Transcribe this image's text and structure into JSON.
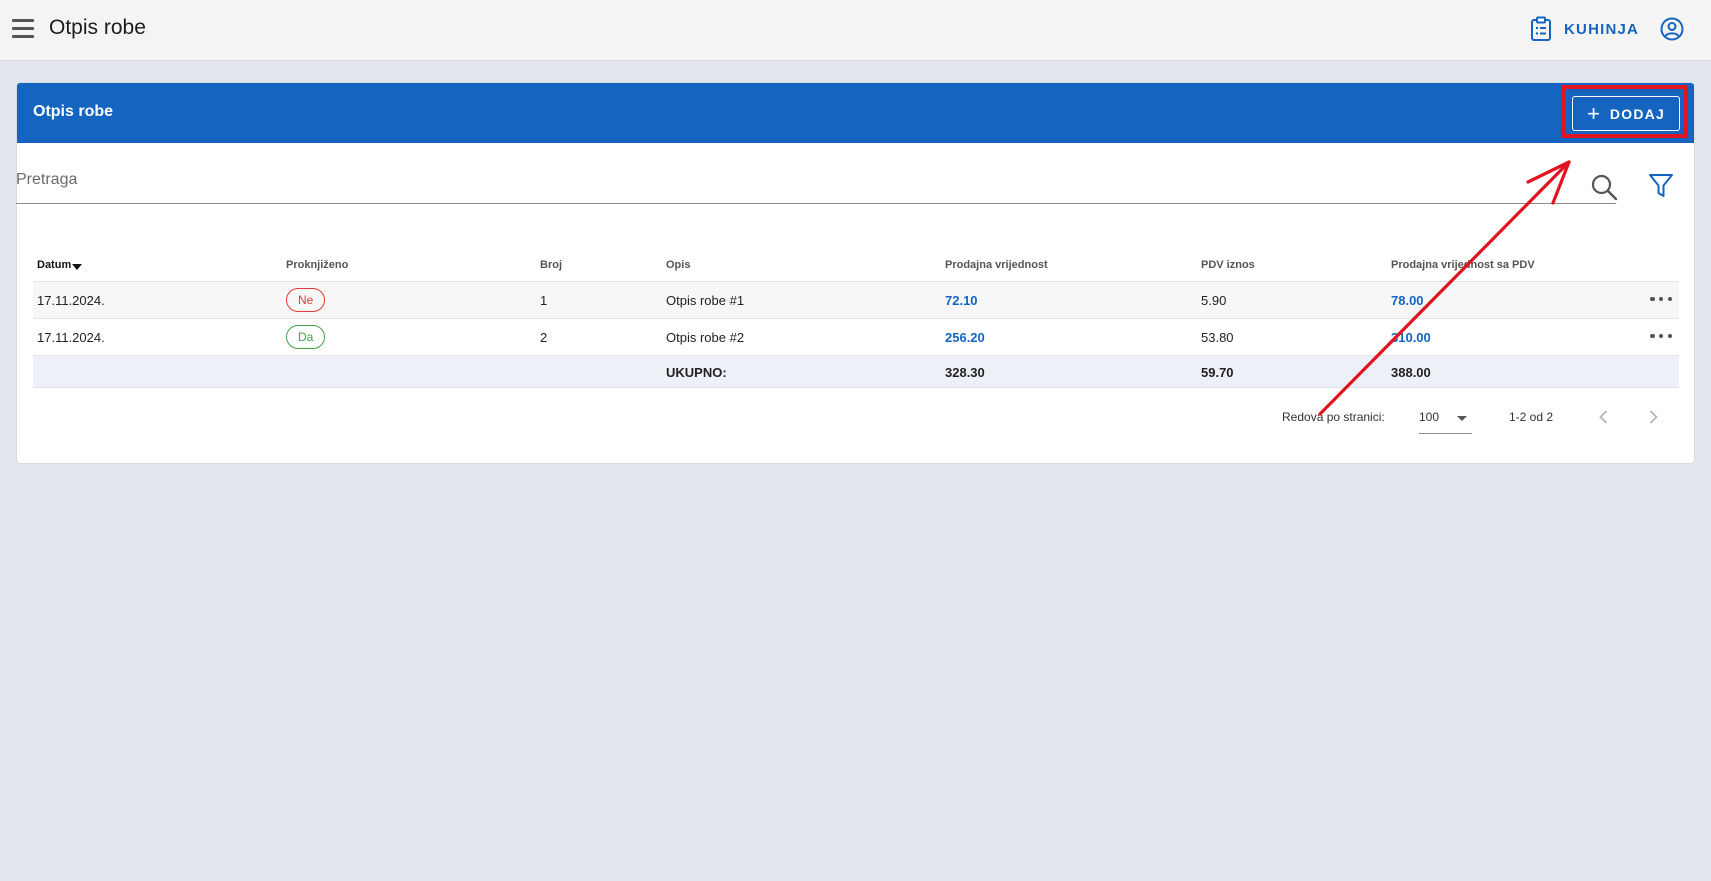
{
  "header": {
    "title": "Otpis robe",
    "location_label": "KUHINJA"
  },
  "card": {
    "title": "Otpis robe",
    "add_label": "DODAJ",
    "add_symbol": "+"
  },
  "search": {
    "placeholder": "Pretraga",
    "value": ""
  },
  "table": {
    "columns": [
      "Datum",
      "Proknjiženo",
      "Broj",
      "Opis",
      "Prodajna vrijednost",
      "PDV iznos",
      "Prodajna vrijednost sa PDV"
    ],
    "rows": [
      {
        "datum": "17.11.2024.",
        "proknjizeno": "Ne",
        "broj": "1",
        "opis": "Otpis robe #1",
        "prodajna": "72.10",
        "pdv": "5.90",
        "sa_pdv": "78.00"
      },
      {
        "datum": "17.11.2024.",
        "proknjizeno": "Da",
        "broj": "2",
        "opis": "Otpis robe #2",
        "prodajna": "256.20",
        "pdv": "53.80",
        "sa_pdv": "310.00"
      }
    ],
    "total": {
      "label": "UKUPNO:",
      "prodajna": "328.30",
      "pdv": "59.70",
      "sa_pdv": "388.00"
    }
  },
  "pagination": {
    "rows_label": "Redova po stranici:",
    "rows_per_page": "100",
    "range": "1-2 od 2"
  },
  "colors": {
    "primary": "#1565c0",
    "annotation": "#e0141f",
    "status_no": "#e53935",
    "status_yes": "#43a047"
  }
}
